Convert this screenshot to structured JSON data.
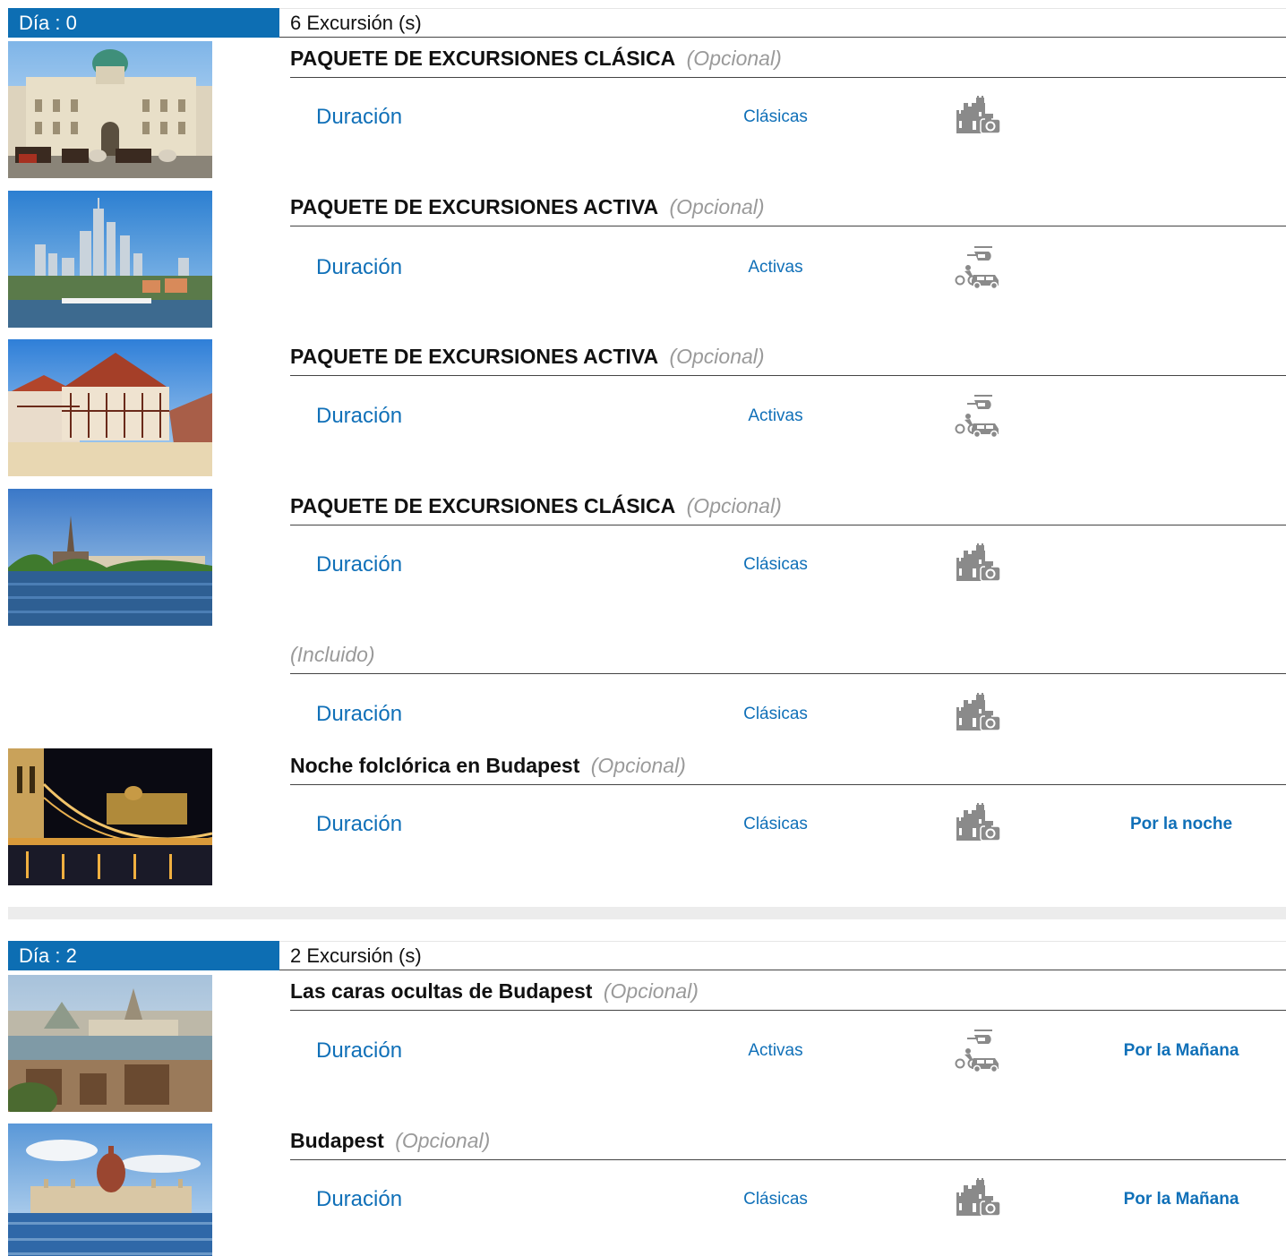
{
  "days": [
    {
      "label": "Día : 0",
      "count": "6 Excursión (s)",
      "excursions": [
        {
          "title": "PAQUETE DE EXCURSIONES CLÁSICA",
          "optional": "(Opcional)",
          "duration": "Duración",
          "category": "Clásicas",
          "icon": "castle-camera-icon",
          "time": ""
        },
        {
          "title": "PAQUETE DE EXCURSIONES ACTIVA",
          "optional": "(Opcional)",
          "duration": "Duración",
          "category": "Activas",
          "icon": "helicopter-bike-car-icon",
          "time": ""
        },
        {
          "title": "PAQUETE DE EXCURSIONES ACTIVA",
          "optional": "(Opcional)",
          "duration": "Duración",
          "category": "Activas",
          "icon": "helicopter-bike-car-icon",
          "time": ""
        },
        {
          "title": "PAQUETE DE EXCURSIONES CLÁSICA",
          "optional": "(Opcional)",
          "duration": "Duración",
          "category": "Clásicas",
          "icon": "castle-camera-icon",
          "time": ""
        },
        {
          "title": "",
          "optional": "(Incluido)",
          "duration": "Duración",
          "category": "Clásicas",
          "icon": "castle-camera-icon",
          "time": ""
        },
        {
          "title": "Noche folclórica en Budapest",
          "optional": "(Opcional)",
          "duration": "Duración",
          "category": "Clásicas",
          "icon": "castle-camera-icon",
          "time": "Por la noche"
        }
      ]
    },
    {
      "label": "Día : 2",
      "count": "2 Excursión (s)",
      "excursions": [
        {
          "title": "Las caras ocultas de Budapest",
          "optional": "(Opcional)",
          "duration": "Duración",
          "category": "Activas",
          "icon": "helicopter-bike-car-icon",
          "time": "Por la Mañana"
        },
        {
          "title": "Budapest",
          "optional": "(Opcional)",
          "duration": "Duración",
          "category": "Clásicas",
          "icon": "castle-camera-icon",
          "time": "Por la Mañana"
        }
      ]
    }
  ],
  "colors": {
    "accent": "#0d6eb3",
    "link": "#1070b8",
    "muted": "#9a9a9a"
  }
}
